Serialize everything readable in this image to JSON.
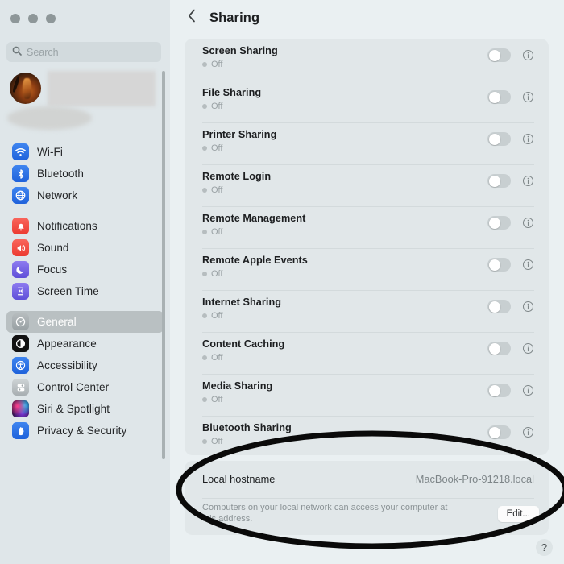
{
  "window": {
    "traffic_lights": [
      "close",
      "minimize",
      "zoom"
    ]
  },
  "sidebar": {
    "search": {
      "placeholder": "Search",
      "value": "",
      "icon": "search-icon"
    },
    "profile": {
      "redacted": true,
      "avatar_icon": "user-avatar"
    },
    "groups": [
      {
        "items": [
          {
            "label": "Wi-Fi",
            "icon": "wifi-icon",
            "tile": "t-blue",
            "selected": false
          },
          {
            "label": "Bluetooth",
            "icon": "bluetooth-icon",
            "tile": "t-blue",
            "selected": false
          },
          {
            "label": "Network",
            "icon": "network-globe-icon",
            "tile": "t-blue",
            "selected": false
          }
        ]
      },
      {
        "items": [
          {
            "label": "Notifications",
            "icon": "bell-icon",
            "tile": "t-red",
            "selected": false
          },
          {
            "label": "Sound",
            "icon": "speaker-icon",
            "tile": "t-red",
            "selected": false
          },
          {
            "label": "Focus",
            "icon": "moon-icon",
            "tile": "t-purple",
            "selected": false
          },
          {
            "label": "Screen Time",
            "icon": "hourglass-icon",
            "tile": "t-purple",
            "selected": false
          }
        ]
      },
      {
        "items": [
          {
            "label": "General",
            "icon": "gear-icon",
            "tile": "t-gray",
            "selected": true
          },
          {
            "label": "Appearance",
            "icon": "appearance-contrast-icon",
            "tile": "t-black",
            "selected": false
          },
          {
            "label": "Accessibility",
            "icon": "accessibility-person-icon",
            "tile": "t-blue",
            "selected": false
          },
          {
            "label": "Control Center",
            "icon": "control-center-icon",
            "tile": "t-cc",
            "selected": false
          },
          {
            "label": "Siri & Spotlight",
            "icon": "siri-icon",
            "tile": "t-siri",
            "selected": false
          },
          {
            "label": "Privacy & Security",
            "icon": "privacy-hand-icon",
            "tile": "t-blue",
            "selected": false
          }
        ]
      }
    ]
  },
  "main": {
    "back_icon": "chevron-left-icon",
    "title": "Sharing",
    "services": [
      {
        "title": "Screen Sharing",
        "status": "Off",
        "enabled": false
      },
      {
        "title": "File Sharing",
        "status": "Off",
        "enabled": false
      },
      {
        "title": "Printer Sharing",
        "status": "Off",
        "enabled": false
      },
      {
        "title": "Remote Login",
        "status": "Off",
        "enabled": false
      },
      {
        "title": "Remote Management",
        "status": "Off",
        "enabled": false
      },
      {
        "title": "Remote Apple Events",
        "status": "Off",
        "enabled": false
      },
      {
        "title": "Internet Sharing",
        "status": "Off",
        "enabled": false
      },
      {
        "title": "Content Caching",
        "status": "Off",
        "enabled": false
      },
      {
        "title": "Media Sharing",
        "status": "Off",
        "enabled": false
      },
      {
        "title": "Bluetooth Sharing",
        "status": "Off",
        "enabled": false
      }
    ],
    "hostname": {
      "label": "Local hostname",
      "value": "MacBook-Pro-91218.local",
      "description": "Computers on your local network can access your computer at this address.",
      "edit_label": "Edit..."
    },
    "help_label": "?"
  },
  "annotation": {
    "type": "ellipse",
    "color": "#0a0a0a",
    "target": "Local hostname"
  }
}
